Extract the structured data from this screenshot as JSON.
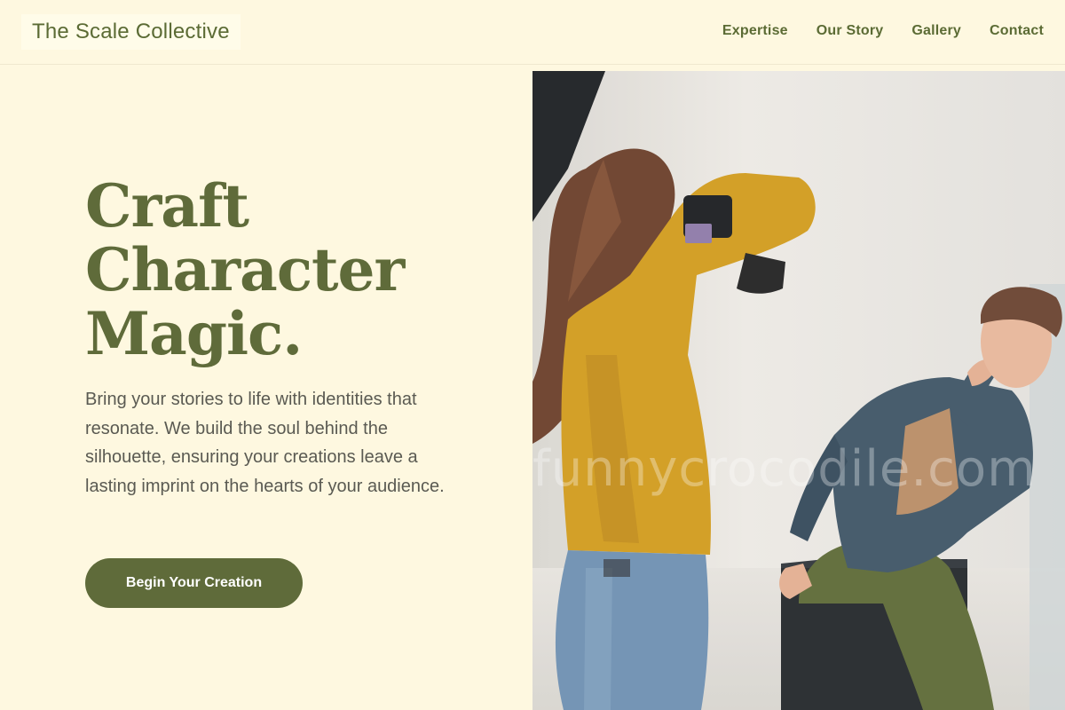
{
  "header": {
    "brand": "The Scale Collective",
    "nav": [
      "Expertise",
      "Our Story",
      "Gallery",
      "Contact"
    ]
  },
  "hero": {
    "title_lines": [
      "Craft",
      "Character",
      "Magic."
    ],
    "description": "Bring your stories to life with identities that resonate. We build the soul behind the silhouette, ensuring your creations leave a lasting imprint on the hearts of your audience.",
    "cta_label": "Begin Your Creation",
    "image_watermark": "funnycrocodile.com"
  },
  "colors": {
    "background": "#fef8e0",
    "accent": "#5f6b3a",
    "body_text": "#5a5a52"
  }
}
